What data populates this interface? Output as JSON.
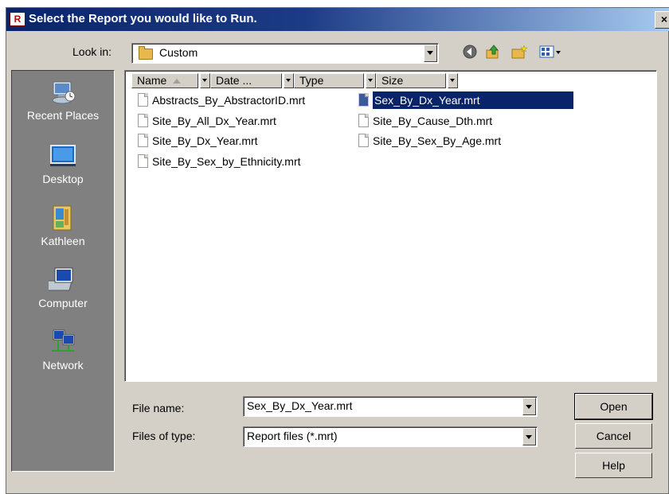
{
  "dialog": {
    "title": "Select the Report you would like to Run.",
    "app_icon_text": "R",
    "close_label": "×"
  },
  "lookin": {
    "label": "Look in:",
    "value": "Custom"
  },
  "toolbar": {
    "back_icon": "back-icon",
    "up_icon": "up-folder-icon",
    "new_folder_icon": "new-folder-icon",
    "views_icon": "views-menu-icon"
  },
  "places": [
    {
      "label": "Recent Places",
      "icon": "recent-places-icon"
    },
    {
      "label": "Desktop",
      "icon": "desktop-icon"
    },
    {
      "label": "Kathleen",
      "icon": "user-folder-icon"
    },
    {
      "label": "Computer",
      "icon": "computer-icon"
    },
    {
      "label": "Network",
      "icon": "network-icon"
    }
  ],
  "columns": [
    "Name",
    "Date ...",
    "Type",
    "Size"
  ],
  "files": [
    {
      "name": "Abstracts_By_AbstractorID.mrt"
    },
    {
      "name": "Site_By_All_Dx_Year.mrt"
    },
    {
      "name": "Site_By_Dx_Year.mrt"
    },
    {
      "name": "Site_By_Sex_by_Ethnicity.mrt"
    },
    {
      "name": "Sex_By_Dx_Year.mrt",
      "selected": true
    },
    {
      "name": "Site_By_Cause_Dth.mrt"
    },
    {
      "name": "Site_By_Sex_By_Age.mrt"
    }
  ],
  "filename": {
    "label": "File name:",
    "value": "Sex_By_Dx_Year.mrt"
  },
  "filetype": {
    "label": "Files of type:",
    "value": "Report files (*.mrt)"
  },
  "buttons": {
    "open": "Open",
    "cancel": "Cancel",
    "help": "Help"
  },
  "colors": {
    "title_bar": "#0a246a",
    "selection": "#0a246a",
    "dialog_bg": "#d4d0c8",
    "places_bg": "#808080"
  }
}
